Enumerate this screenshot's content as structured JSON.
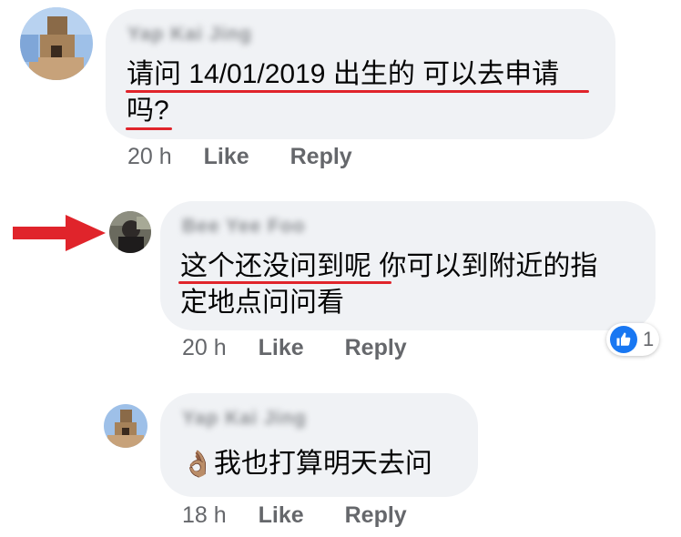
{
  "comments": [
    {
      "author": "Yap Kai Jing",
      "lines": [
        "请问 14/01/2019 出生的 可以去申请",
        "吗?"
      ],
      "time": "20 h",
      "like_label": "Like",
      "reply_label": "Reply"
    },
    {
      "author": "Bee Yee Foo",
      "lines": [
        "这个还没问到呢 你可以到附近的指",
        "定地点问问看"
      ],
      "time": "20 h",
      "like_label": "Like",
      "reply_label": "Reply",
      "reaction": {
        "icon": "thumbs-up-icon",
        "count": "1",
        "color": "#1877f2"
      }
    },
    {
      "author": "Yap Kai Jing",
      "emoji": "👌🏽",
      "text": "我也打算明天去问",
      "time": "18 h",
      "like_label": "Like",
      "reply_label": "Reply"
    }
  ],
  "annotations": {
    "arrow_color": "#e0242b",
    "underline_color": "#e0242b"
  },
  "colors": {
    "bubble": "#f0f2f5",
    "meta_text": "#65676b",
    "body_text": "#050505"
  }
}
